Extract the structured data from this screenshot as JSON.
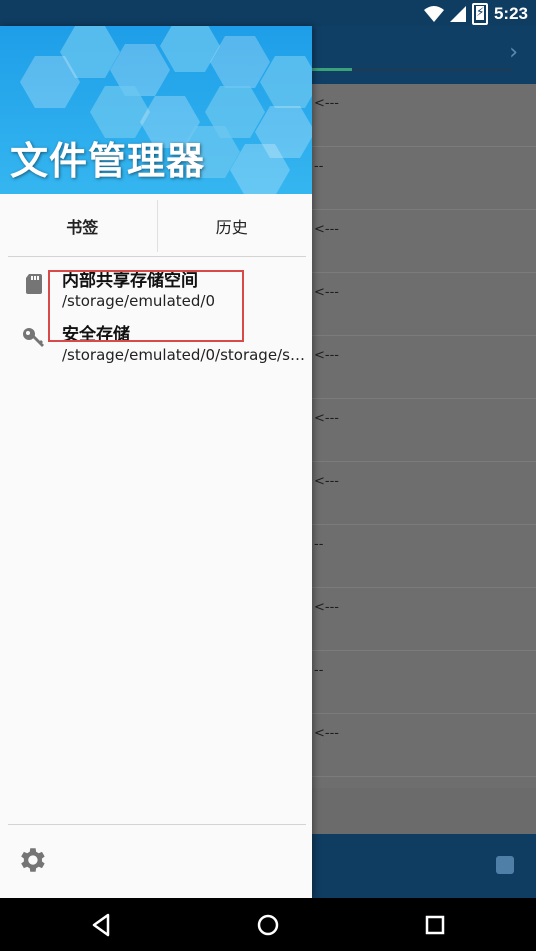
{
  "status_bar": {
    "time": "5:23",
    "battery_glyph": "⚡"
  },
  "drawer": {
    "title": "文件管理器",
    "tabs": [
      {
        "label": "书签",
        "active": true
      },
      {
        "label": "历史",
        "active": false
      }
    ],
    "bookmarks": [
      {
        "title": "内部共享存储空间",
        "path": "/storage/emulated/0",
        "icon": "sd-card-icon"
      },
      {
        "title": "安全存储",
        "path": "/storage/emulated/0/storage/se...",
        "icon": "key-icon"
      }
    ],
    "settings_icon": "gear-icon"
  },
  "background": {
    "chevron": "›",
    "rows": [
      "<---",
      "--",
      "<---",
      "<---",
      "<---",
      "<---",
      "<---",
      "--",
      "<---",
      "--",
      "<---"
    ]
  },
  "colors": {
    "accent": "#1e9ee8",
    "toolbar": "#103f66",
    "highlight": "#d84a4a"
  }
}
